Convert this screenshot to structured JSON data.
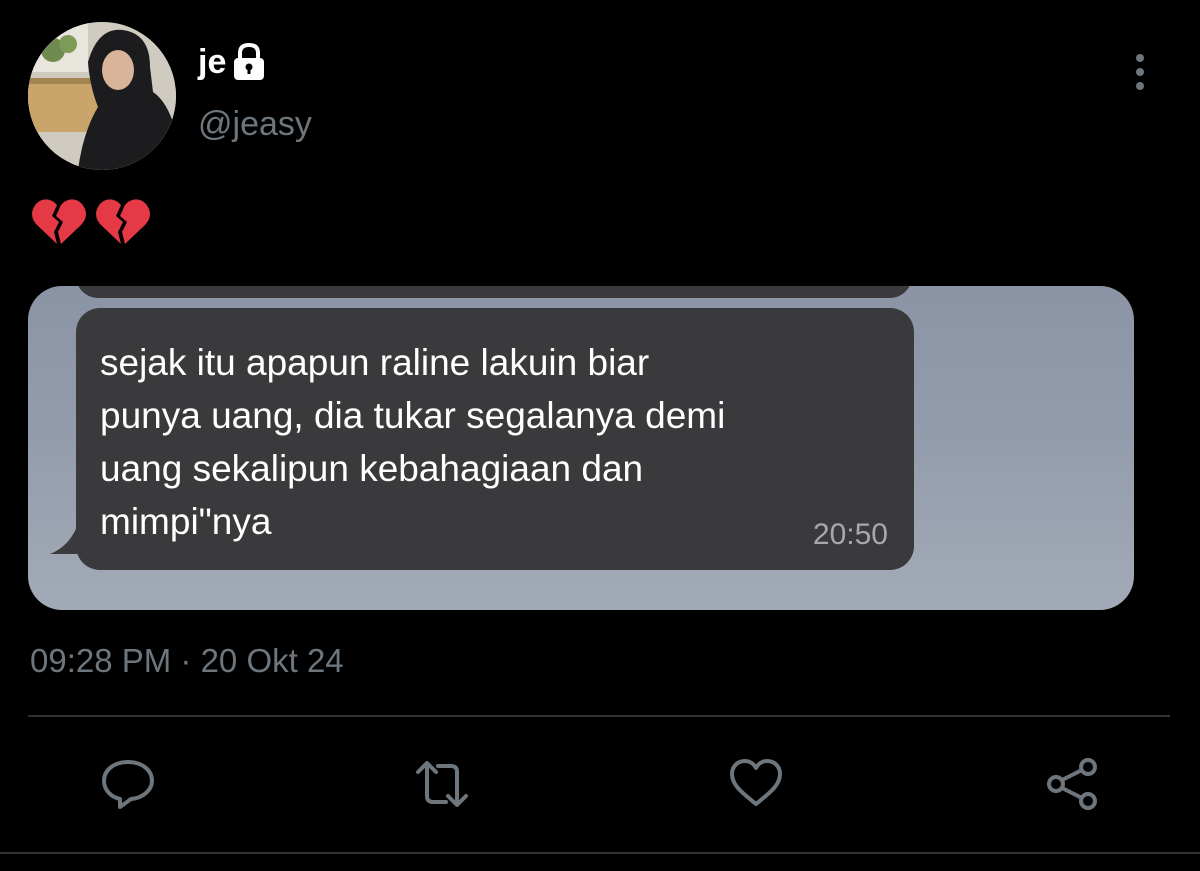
{
  "author": {
    "display_name": "je",
    "handle": "@jeasy",
    "protected_icon": "lock-icon",
    "avatar": "profile-photo"
  },
  "tweet": {
    "emoji": [
      "💔",
      "💔"
    ],
    "media": {
      "chat_message": "sejak itu apapun raline lakuin biar\npunya uang, dia tukar segalanya demi\nuang sekalipun kebahagiaan dan\nmimpi\"nya",
      "chat_time": "20:50"
    },
    "timestamp": "09:28 PM · 20 Okt 24"
  },
  "actions": [
    {
      "name": "reply",
      "icon": "reply-icon"
    },
    {
      "name": "retweet",
      "icon": "retweet-icon"
    },
    {
      "name": "like",
      "icon": "heart-icon"
    },
    {
      "name": "share",
      "icon": "share-icon"
    }
  ],
  "menu_icon": "more-vertical-icon",
  "colors": {
    "background": "#000000",
    "secondary_text": "#6e767d",
    "icon": "#6e767d",
    "bubble": "#3a3a3c",
    "broken_heart": "#e53946"
  }
}
